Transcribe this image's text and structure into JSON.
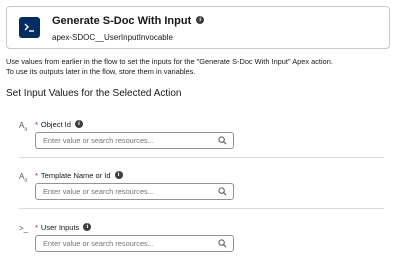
{
  "action": {
    "title": "Generate S-Doc With Input",
    "api_name": "apex-SDOC__UserInputInvocable",
    "icon": "apex-action-icon",
    "icon_color": "#032d60"
  },
  "description": {
    "line1": "Use values from earlier in the flow to set the inputs for the \"Generate S-Doc With Input\" Apex action.",
    "line2": "To use its outputs later in the flow, store them in variables."
  },
  "section": {
    "title": "Set Input Values for the Selected Action"
  },
  "fields": [
    {
      "type_icon": "text",
      "required_mark": "*",
      "label": "Object Id",
      "placeholder": "Enter value or search resources...",
      "value": ""
    },
    {
      "type_icon": "text",
      "required_mark": "*",
      "label": "Template Name or Id",
      "placeholder": "Enter value or search resources...",
      "value": ""
    },
    {
      "type_icon": "apex",
      "required_mark": "*",
      "label": "User Inputs",
      "placeholder": "Enter value or search resources...",
      "value": ""
    }
  ],
  "colors": {
    "required": "#ba0517",
    "border": "#c9c9c9",
    "text": "#181818"
  }
}
